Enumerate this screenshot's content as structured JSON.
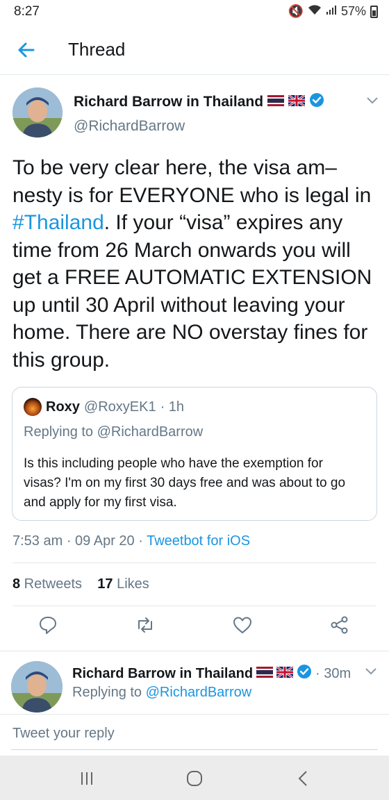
{
  "status_bar": {
    "time": "8:27",
    "battery": "57%"
  },
  "app_bar": {
    "title": "Thread"
  },
  "tweet": {
    "author": "Richard Barrow in Thailand",
    "handle": "@RichardBarrow",
    "text_lines": [
      "To be very clear here, the visa am–",
      "nesty is for EVERYONE who is legal in",
      "#Thailand",
      ". If your “visa” expires any",
      "time from 26 March onwards you will",
      "get a FREE AUTOMATIC EXTENSION",
      "up until 30 April without leaving your",
      "home. There are NO overstay fines for",
      "this group."
    ],
    "quote": {
      "name": "Roxy",
      "handle": "@RoxyEK1",
      "time": "· 1h",
      "replying": "Replying to @RichardBarrow",
      "text": "Is this including people who have the exemption for visas? I'm on my first 30 days free and was about to go and apply for my first visa."
    },
    "timestamp": "7:53 am · 09 Apr 20 · ",
    "via": "Tweetbot for iOS",
    "retweets_count": "8",
    "retweets_label": " Retweets",
    "likes_count": "17",
    "likes_label": " Likes"
  },
  "reply": {
    "author": "Richard Barrow in Thailand",
    "ago": "· 30m",
    "replying_prefix": "Replying to ",
    "replying_mention": "@RichardBarrow"
  },
  "compose": {
    "placeholder": "Tweet your reply"
  },
  "colors": {
    "accent": "#1b95e0",
    "secondary_text": "#657786",
    "divider": "#e1e8ed"
  }
}
